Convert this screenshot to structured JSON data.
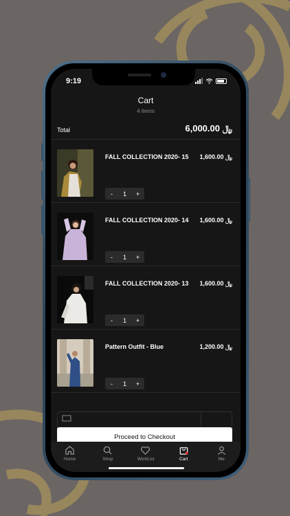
{
  "status_bar": {
    "time": "9:19"
  },
  "header": {
    "title": "Cart",
    "subtitle": "4 items"
  },
  "total": {
    "label": "Total",
    "value": "6,000.00 ﷼"
  },
  "items": [
    {
      "name": "FALL COLLECTION 2020- 15",
      "price": "1,600.00 ﷼",
      "qty": "1",
      "minus": "-",
      "plus": "+"
    },
    {
      "name": "FALL COLLECTION 2020- 14",
      "price": "1,600.00 ﷼",
      "qty": "1",
      "minus": "-",
      "plus": "+"
    },
    {
      "name": "FALL COLLECTION 2020- 13",
      "price": "1,600.00 ﷼",
      "qty": "1",
      "minus": "-",
      "plus": "+"
    },
    {
      "name": "Pattern Outfit - Blue",
      "price": "1,200.00 ﷼",
      "qty": "1",
      "minus": "-",
      "plus": "+"
    }
  ],
  "checkout": {
    "label": "Proceed to Checkout"
  },
  "tabs": [
    {
      "label": "Home",
      "icon": "home-icon"
    },
    {
      "label": "Shop",
      "icon": "search-icon"
    },
    {
      "label": "WishList",
      "icon": "heart-icon"
    },
    {
      "label": "Cart",
      "icon": "bag-icon",
      "active": true
    },
    {
      "label": "Me",
      "icon": "user-icon"
    }
  ],
  "colors": {
    "background": "#6b6563",
    "decor": "#a08d5c",
    "screen": "#161616",
    "badge": "#d9323a"
  }
}
